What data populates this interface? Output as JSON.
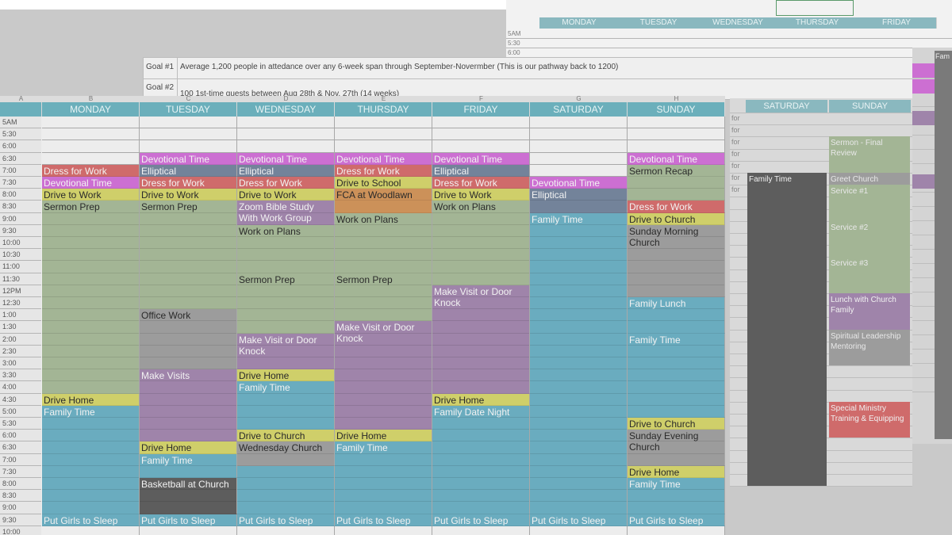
{
  "top_sheet": {
    "days": [
      "MONDAY",
      "TUESDAY",
      "WEDNESDAY",
      "THURSDAY",
      "FRIDAY"
    ],
    "times": [
      "5AM",
      "5:30",
      "6:00"
    ]
  },
  "goals": [
    {
      "label": "Goal #1",
      "text": "Average 1,200 people in attedance over any 6-week span through September-Novermber (This is our pathway back to 1200)"
    },
    {
      "label": "Goal #2",
      "text": "100 1st-time guests between Aug 28th & Nov. 27th (14 weeks)"
    }
  ],
  "columns": [
    "A",
    "B",
    "C",
    "D",
    "E",
    "F",
    "G",
    "H"
  ],
  "days": [
    "MONDAY",
    "TUESDAY",
    "WEDNESDAY",
    "THURSDAY",
    "FRIDAY",
    "SATURDAY",
    "SUNDAY"
  ],
  "times": [
    "5AM",
    "5:30",
    "6:00",
    "6:30",
    "7:00",
    "7:30",
    "8:00",
    "8:30",
    "9:00",
    "9:30",
    "10:00",
    "10:30",
    "11:00",
    "11:30",
    "12PM",
    "12:30",
    "1:00",
    "1:30",
    "2:00",
    "2:30",
    "3:00",
    "3:30",
    "4:00",
    "4:30",
    "5:00",
    "5:30",
    "6:00",
    "6:30",
    "7:00",
    "7:30",
    "8:00",
    "8:30",
    "9:00",
    "9:30",
    "10:00"
  ],
  "colors": {
    "pink": "#cc6fd2",
    "slate": "#73839a",
    "red": "#cf6b6b",
    "yellow": "#cfcf6a",
    "sage": "#a3b595",
    "purple": "#9f84aa",
    "blue": "#6aacbf",
    "gray": "#9c9c9c",
    "dark": "#5d5d5d",
    "orange": "#cc9159",
    "header": "#6bafbb"
  },
  "events": [
    {
      "d": 0,
      "s": 4,
      "n": 1,
      "t": "Dress for Work",
      "c": "red"
    },
    {
      "d": 0,
      "s": 5,
      "n": 1,
      "t": "Devotional Time",
      "c": "pink"
    },
    {
      "d": 0,
      "s": 6,
      "n": 1,
      "t": "Drive to Work",
      "c": "yellow"
    },
    {
      "d": 0,
      "s": 7,
      "n": 16,
      "t": "Sermon Prep",
      "c": "sage"
    },
    {
      "d": 0,
      "s": 23,
      "n": 1,
      "t": "Drive Home",
      "c": "yellow"
    },
    {
      "d": 0,
      "s": 24,
      "n": 9,
      "t": "Family Time",
      "c": "blue"
    },
    {
      "d": 0,
      "s": 33,
      "n": 1,
      "t": "Put Girls to Sleep",
      "c": "blue"
    },
    {
      "d": 1,
      "s": 3,
      "n": 1,
      "t": "Devotional Time",
      "c": "pink"
    },
    {
      "d": 1,
      "s": 4,
      "n": 1,
      "t": "Elliptical",
      "c": "slate"
    },
    {
      "d": 1,
      "s": 5,
      "n": 1,
      "t": "Dress for Work",
      "c": "red"
    },
    {
      "d": 1,
      "s": 6,
      "n": 1,
      "t": "Drive to Work",
      "c": "yellow"
    },
    {
      "d": 1,
      "s": 7,
      "n": 9,
      "t": "Sermon Prep",
      "c": "sage"
    },
    {
      "d": 1,
      "s": 16,
      "n": 5,
      "t": "Office Work",
      "c": "gray"
    },
    {
      "d": 1,
      "s": 21,
      "n": 6,
      "t": "Make Visits",
      "c": "purple"
    },
    {
      "d": 1,
      "s": 27,
      "n": 1,
      "t": "Drive Home",
      "c": "yellow"
    },
    {
      "d": 1,
      "s": 28,
      "n": 2,
      "t": "Family Time",
      "c": "blue"
    },
    {
      "d": 1,
      "s": 30,
      "n": 3,
      "t": "Basketball at Church",
      "c": "dark"
    },
    {
      "d": 1,
      "s": 33,
      "n": 1,
      "t": "Put Girls to Sleep",
      "c": "blue"
    },
    {
      "d": 2,
      "s": 3,
      "n": 1,
      "t": "Devotional Time",
      "c": "pink"
    },
    {
      "d": 2,
      "s": 4,
      "n": 1,
      "t": "Elliptical",
      "c": "slate"
    },
    {
      "d": 2,
      "s": 5,
      "n": 1,
      "t": "Dress for Work",
      "c": "red"
    },
    {
      "d": 2,
      "s": 6,
      "n": 1,
      "t": "Drive to Work",
      "c": "yellow"
    },
    {
      "d": 2,
      "s": 7,
      "n": 2,
      "t": "Zoom Bible Study With Work Group",
      "c": "purple"
    },
    {
      "d": 2,
      "s": 9,
      "n": 4,
      "t": "Work on Plans",
      "c": "sage"
    },
    {
      "d": 2,
      "s": 13,
      "n": 5,
      "t": "Sermon Prep",
      "c": "sage"
    },
    {
      "d": 2,
      "s": 18,
      "n": 3,
      "t": "Make Visit or Door Knock",
      "c": "purple"
    },
    {
      "d": 2,
      "s": 21,
      "n": 1,
      "t": "Drive Home",
      "c": "yellow"
    },
    {
      "d": 2,
      "s": 22,
      "n": 4,
      "t": "Family Time",
      "c": "blue"
    },
    {
      "d": 2,
      "s": 26,
      "n": 1,
      "t": "Drive to Church",
      "c": "yellow"
    },
    {
      "d": 2,
      "s": 27,
      "n": 2,
      "t": "Wednesday Church",
      "c": "gray"
    },
    {
      "d": 2,
      "s": 29,
      "n": 4,
      "t": "",
      "c": "blue"
    },
    {
      "d": 2,
      "s": 33,
      "n": 1,
      "t": "Put Girls to Sleep",
      "c": "blue"
    },
    {
      "d": 3,
      "s": 3,
      "n": 1,
      "t": "Devotional Time",
      "c": "pink"
    },
    {
      "d": 3,
      "s": 4,
      "n": 1,
      "t": "Dress for Work",
      "c": "red"
    },
    {
      "d": 3,
      "s": 5,
      "n": 1,
      "t": "Drive to School",
      "c": "yellow"
    },
    {
      "d": 3,
      "s": 6,
      "n": 1,
      "t": "FCA at Woodlawn",
      "c": "orange"
    },
    {
      "d": 3,
      "s": 7,
      "n": 1,
      "t": "",
      "c": "orange"
    },
    {
      "d": 3,
      "s": 8,
      "n": 5,
      "t": "Work on Plans",
      "c": "sage"
    },
    {
      "d": 3,
      "s": 13,
      "n": 4,
      "t": "Sermon Prep",
      "c": "sage"
    },
    {
      "d": 3,
      "s": 17,
      "n": 9,
      "t": "Make Visit or Door Knock",
      "c": "purple"
    },
    {
      "d": 3,
      "s": 26,
      "n": 1,
      "t": "Drive Home",
      "c": "yellow"
    },
    {
      "d": 3,
      "s": 27,
      "n": 6,
      "t": "Family Time",
      "c": "blue"
    },
    {
      "d": 3,
      "s": 33,
      "n": 1,
      "t": "Put Girls to Sleep",
      "c": "blue"
    },
    {
      "d": 4,
      "s": 3,
      "n": 1,
      "t": "Devotional Time",
      "c": "pink"
    },
    {
      "d": 4,
      "s": 4,
      "n": 1,
      "t": "Elliptical",
      "c": "slate"
    },
    {
      "d": 4,
      "s": 5,
      "n": 1,
      "t": "Dress for Work",
      "c": "red"
    },
    {
      "d": 4,
      "s": 6,
      "n": 1,
      "t": "Drive to Work",
      "c": "yellow"
    },
    {
      "d": 4,
      "s": 7,
      "n": 7,
      "t": "Work on Plans",
      "c": "sage"
    },
    {
      "d": 4,
      "s": 14,
      "n": 9,
      "t": "Make Visit or Door Knock",
      "c": "purple"
    },
    {
      "d": 4,
      "s": 23,
      "n": 1,
      "t": "Drive Home",
      "c": "yellow"
    },
    {
      "d": 4,
      "s": 24,
      "n": 9,
      "t": "Family Date Night",
      "c": "blue"
    },
    {
      "d": 4,
      "s": 33,
      "n": 1,
      "t": "Put Girls to Sleep",
      "c": "blue"
    },
    {
      "d": 5,
      "s": 5,
      "n": 1,
      "t": "Devotional Time",
      "c": "pink"
    },
    {
      "d": 5,
      "s": 6,
      "n": 2,
      "t": "Elliptical",
      "c": "slate"
    },
    {
      "d": 5,
      "s": 8,
      "n": 25,
      "t": "Family Time",
      "c": "blue"
    },
    {
      "d": 5,
      "s": 33,
      "n": 1,
      "t": "Put Girls to Sleep",
      "c": "blue"
    },
    {
      "d": 6,
      "s": 3,
      "n": 1,
      "t": "Devotional Time",
      "c": "pink"
    },
    {
      "d": 6,
      "s": 4,
      "n": 1,
      "t": "Sermon Recap",
      "c": "sage"
    },
    {
      "d": 6,
      "s": 5,
      "n": 2,
      "t": "",
      "c": "sage"
    },
    {
      "d": 6,
      "s": 7,
      "n": 1,
      "t": "Dress for Work",
      "c": "red"
    },
    {
      "d": 6,
      "s": 8,
      "n": 1,
      "t": "Drive to Church",
      "c": "yellow"
    },
    {
      "d": 6,
      "s": 9,
      "n": 6,
      "t": "Sunday Morning Church",
      "c": "gray"
    },
    {
      "d": 6,
      "s": 15,
      "n": 3,
      "t": "Family Lunch",
      "c": "blue"
    },
    {
      "d": 6,
      "s": 18,
      "n": 7,
      "t": "Family Time",
      "c": "blue"
    },
    {
      "d": 6,
      "s": 25,
      "n": 1,
      "t": "Drive to Church",
      "c": "yellow"
    },
    {
      "d": 6,
      "s": 26,
      "n": 3,
      "t": "Sunday Evening Church",
      "c": "gray"
    },
    {
      "d": 6,
      "s": 29,
      "n": 1,
      "t": "Drive Home",
      "c": "yellow"
    },
    {
      "d": 6,
      "s": 30,
      "n": 3,
      "t": "Family Time",
      "c": "blue"
    },
    {
      "d": 6,
      "s": 33,
      "n": 1,
      "t": "Put Girls to Sleep",
      "c": "blue"
    }
  ],
  "right_sheet": {
    "days": [
      "SATURDAY",
      "SUNDAY"
    ],
    "items": [
      {
        "col": 1,
        "s": 2,
        "n": 4,
        "t": "Sermon - Final Review",
        "c": "sage"
      },
      {
        "col": 0,
        "s": 5,
        "n": 26,
        "t": "Family Time",
        "c": "dark"
      },
      {
        "col": 1,
        "s": 5,
        "n": 1,
        "t": "Greet Church",
        "c": "gray"
      },
      {
        "col": 1,
        "s": 6,
        "n": 3,
        "t": "Service #1",
        "c": "sage"
      },
      {
        "col": 1,
        "s": 9,
        "n": 3,
        "t": "Service #2",
        "c": "sage"
      },
      {
        "col": 1,
        "s": 12,
        "n": 3,
        "t": "Service #3",
        "c": "sage"
      },
      {
        "col": 1,
        "s": 15,
        "n": 3,
        "t": "Lunch with Church Family",
        "c": "purple"
      },
      {
        "col": 1,
        "s": 18,
        "n": 3,
        "t": "Spiritual Leadership Mentoring",
        "c": "gray"
      },
      {
        "col": 1,
        "s": 24,
        "n": 3,
        "t": "Special Ministry Training & Equipping",
        "c": "red"
      }
    ],
    "left_labels": [
      "for",
      "for",
      "for",
      "for",
      "for",
      "for",
      "for"
    ]
  },
  "far_sheet": {
    "label": "Fam"
  }
}
